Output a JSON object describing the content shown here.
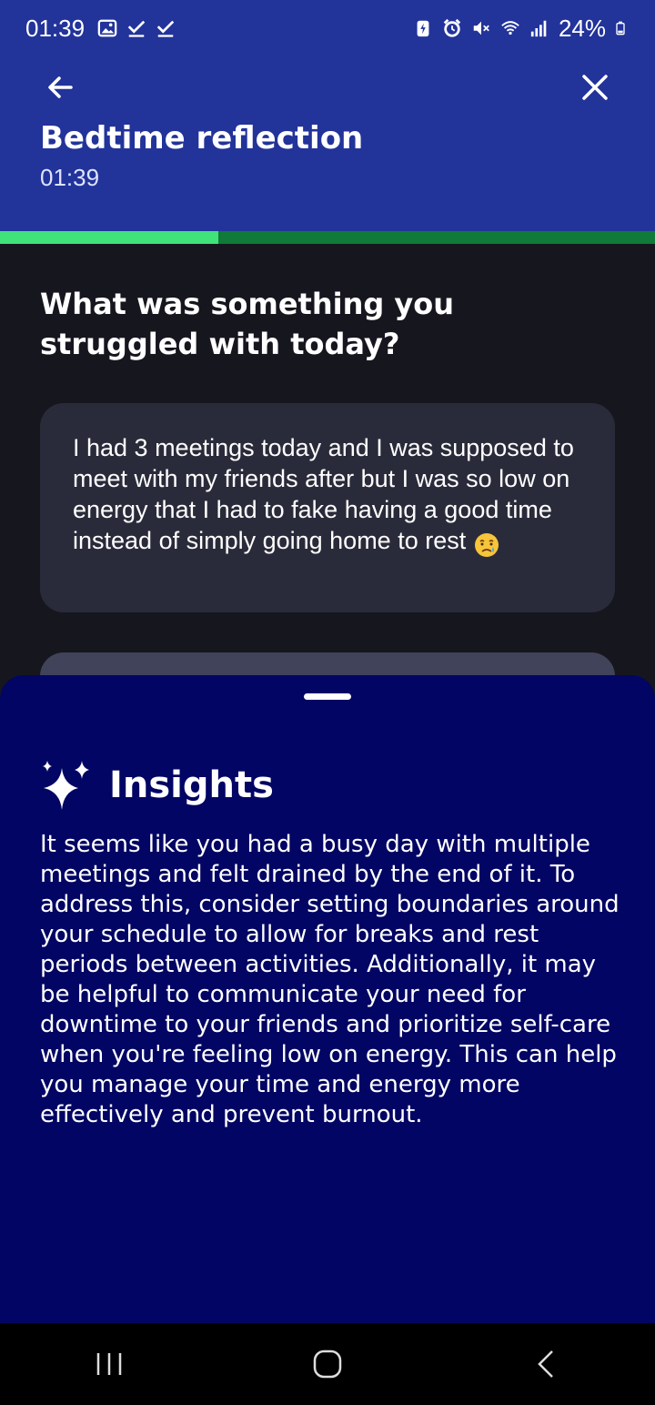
{
  "status_bar": {
    "time": "01:39",
    "battery": "24%",
    "left_icons": [
      "image-icon",
      "check-icon",
      "check-icon"
    ],
    "right_icons": [
      "battery-saver-icon",
      "alarm-icon",
      "mute-icon",
      "wifi-icon",
      "signal-icon",
      "battery-icon"
    ]
  },
  "header": {
    "title": "Bedtime reflection",
    "subtitle": "01:39"
  },
  "progress": {
    "fraction": 0.333,
    "fill_color": "#3fe37a",
    "track_color": "#0f7a39"
  },
  "question": "What was something you struggled with today?",
  "answer": {
    "text": "I had 3 meetings today and I was supposed to meet with my friends after but I was so low on energy that I had to fake having a good time instead of simply going home to rest",
    "emoji": "sad-relieved-face-emoji"
  },
  "insights": {
    "title": "Insights",
    "body": "It seems like you had a busy day with multiple meetings and felt drained by the end of it. To address this, consider setting boundaries around your schedule to allow for breaks and rest periods between activities. Additionally, it may be helpful to communicate your need for downtime to your friends and prioritize self-care when you're feeling low on energy. This can help you manage your time and energy more effectively and prevent burnout."
  },
  "colors": {
    "header_bg": "#22339a",
    "sheet_bg": "#020563",
    "page_bg": "#16161f",
    "card_bg": "#2a2b3a"
  }
}
